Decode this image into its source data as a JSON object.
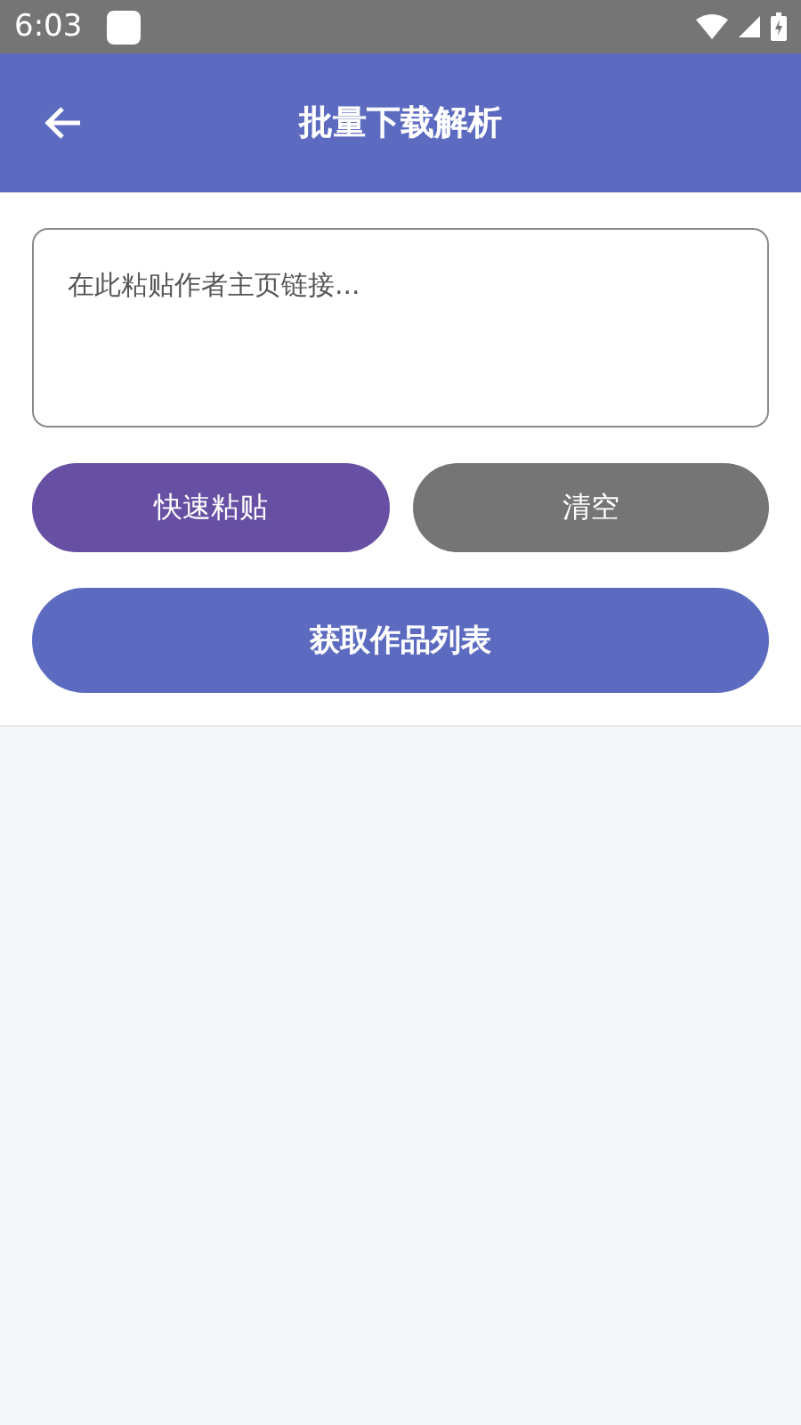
{
  "status_bar": {
    "time": "6:03"
  },
  "app_bar": {
    "title": "批量下载解析"
  },
  "link_field": {
    "placeholder": "在此粘贴作者主页链接..."
  },
  "actions": [
    {
      "label": "快速粘贴",
      "kind": "accent"
    },
    {
      "label": "清空",
      "kind": "neutral"
    }
  ],
  "main_button": {
    "label": "获取作品列表"
  }
}
